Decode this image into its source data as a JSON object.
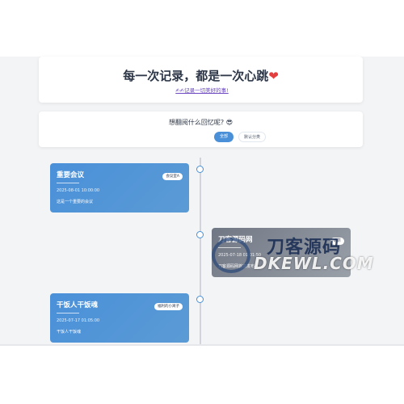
{
  "header": {
    "title": "每一次记录，都是一次心跳",
    "title_emoji": "❤",
    "subtitle": "✍✍记录一切美好的事!"
  },
  "filter": {
    "title": "想翻阅什么回忆呢? 😎",
    "buttons": [
      {
        "label": "全部",
        "active": true
      },
      {
        "label": "默认分类",
        "active": false
      }
    ]
  },
  "timeline": [
    {
      "title": "重要会议",
      "tag": "会议室A",
      "date": "2025-08-01 10:00:00",
      "desc": "这是一个重要的会议",
      "side": "left"
    },
    {
      "title": "刀客源码网",
      "tag": "北京",
      "date": "2025-07-18 01:01:50",
      "desc": "刀客源码网首次发布",
      "side": "right"
    },
    {
      "title": "干饭人干饭魂",
      "tag": "福利的小窝子",
      "date": "2025-07-17 01:05:00",
      "desc": "干饭人干饭魂",
      "side": "left"
    }
  ],
  "watermark": {
    "text_cn": "刀客源码",
    "text_en": "DKEWL.COM"
  },
  "colors": {
    "accent": "#4a90d9",
    "heart": "#e53e3e",
    "subtitle_link": "#6b46c1"
  }
}
